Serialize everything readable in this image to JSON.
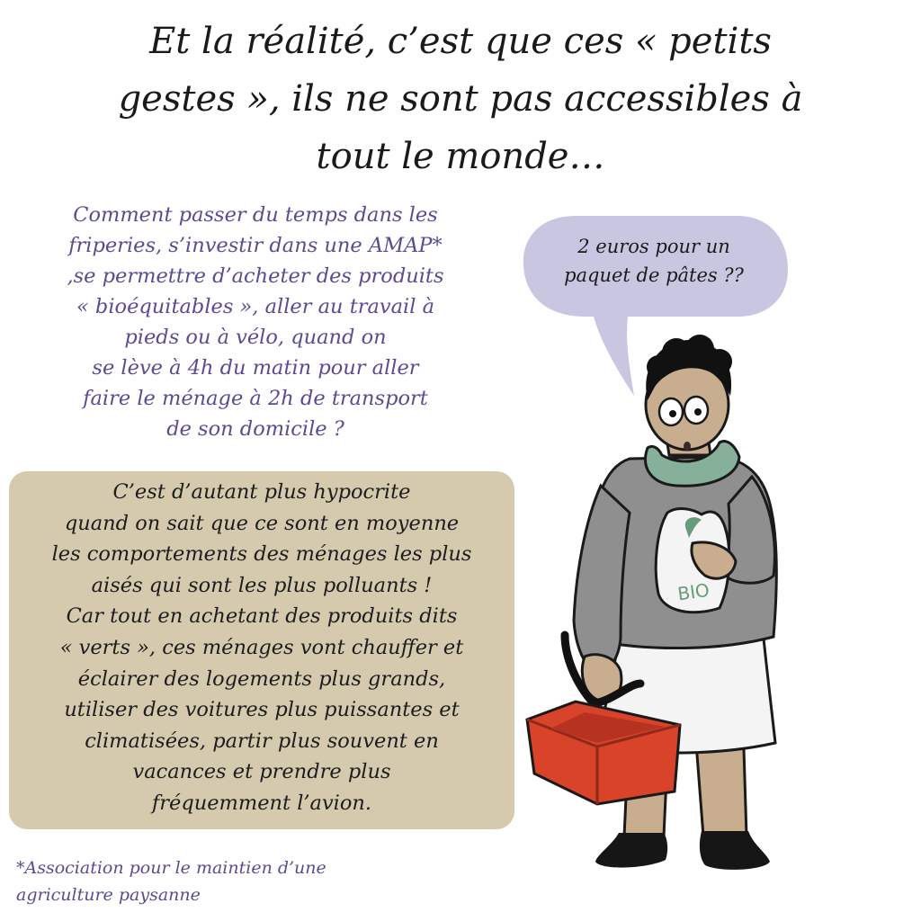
{
  "title": [
    "Et la réalité, c’est que ces « petits",
    "gestes », ils ne sont pas accessibles à",
    "tout le monde…"
  ],
  "question": [
    "Comment passer du temps dans les",
    "friperies, s’investir dans une AMAP*",
    ",se permettre d’acheter des produits",
    "« bioéquitables », aller au travail à",
    "pieds ou à vélo, quand on",
    "se lève à 4h du matin pour aller",
    "faire le ménage à 2h de transport",
    "de son domicile ?"
  ],
  "box_text": [
    "C’est d’autant plus hypocrite",
    "quand on sait que ce sont en moyenne",
    "les comportements des ménages les plus",
    "aisés qui sont les plus polluants !",
    "Car tout en achetant des produits dits",
    "« verts »,  ces ménages vont chauffer et",
    "éclairer des logements plus grands,",
    "utiliser des voitures plus puissantes et",
    "climatisées, partir plus souvent en",
    "vacances et prendre plus",
    "fréquemment l’avion."
  ],
  "footnote": [
    "*Association pour le maintien d’une",
    "agriculture paysanne"
  ],
  "speech_bubble": [
    "2 euros pour un",
    "paquet de pâtes ??"
  ],
  "bag_label": "BIO",
  "colors": {
    "purple_text": "#5c4a93",
    "box_background": "#d5c9ae",
    "bubble": "#c9c6e2",
    "sweater": "#8f8f8f",
    "scarf": "#86b09a",
    "skin": "#c8ad8f",
    "skirt": "#f4f4f4",
    "basket": "#d9432a",
    "bag_logo": "#6a9a7c"
  }
}
